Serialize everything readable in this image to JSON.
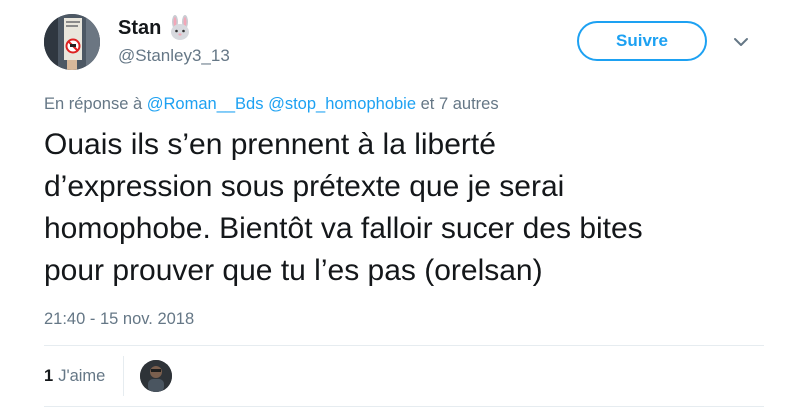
{
  "author": {
    "display_name": "Stan",
    "emoji_icon": "rabbit-face-icon",
    "handle": "@Stanley3_13"
  },
  "follow_button": {
    "label": "Suivre",
    "color": "#1da1f2"
  },
  "reply_context": {
    "prefix": "En réponse à",
    "mentions": [
      "@Roman__Bds",
      "@stop_homophobie"
    ],
    "suffix": "et 7 autres"
  },
  "tweet": {
    "lines": [
      "Ouais ils s’en prennent à la liberté",
      "d’expression sous prétexte que je serai",
      "homophobe. Bientôt va falloir sucer des bites",
      "pour prouver que tu l’es pas (orelsan)"
    ],
    "timestamp": "21:40 - 15 nov. 2018"
  },
  "stats": {
    "likes_count": "1",
    "likes_label": "J'aime"
  },
  "colors": {
    "link": "#1da1f2",
    "secondary_text": "#657786",
    "primary_text": "#14171a",
    "divider": "#e6ecf0"
  }
}
